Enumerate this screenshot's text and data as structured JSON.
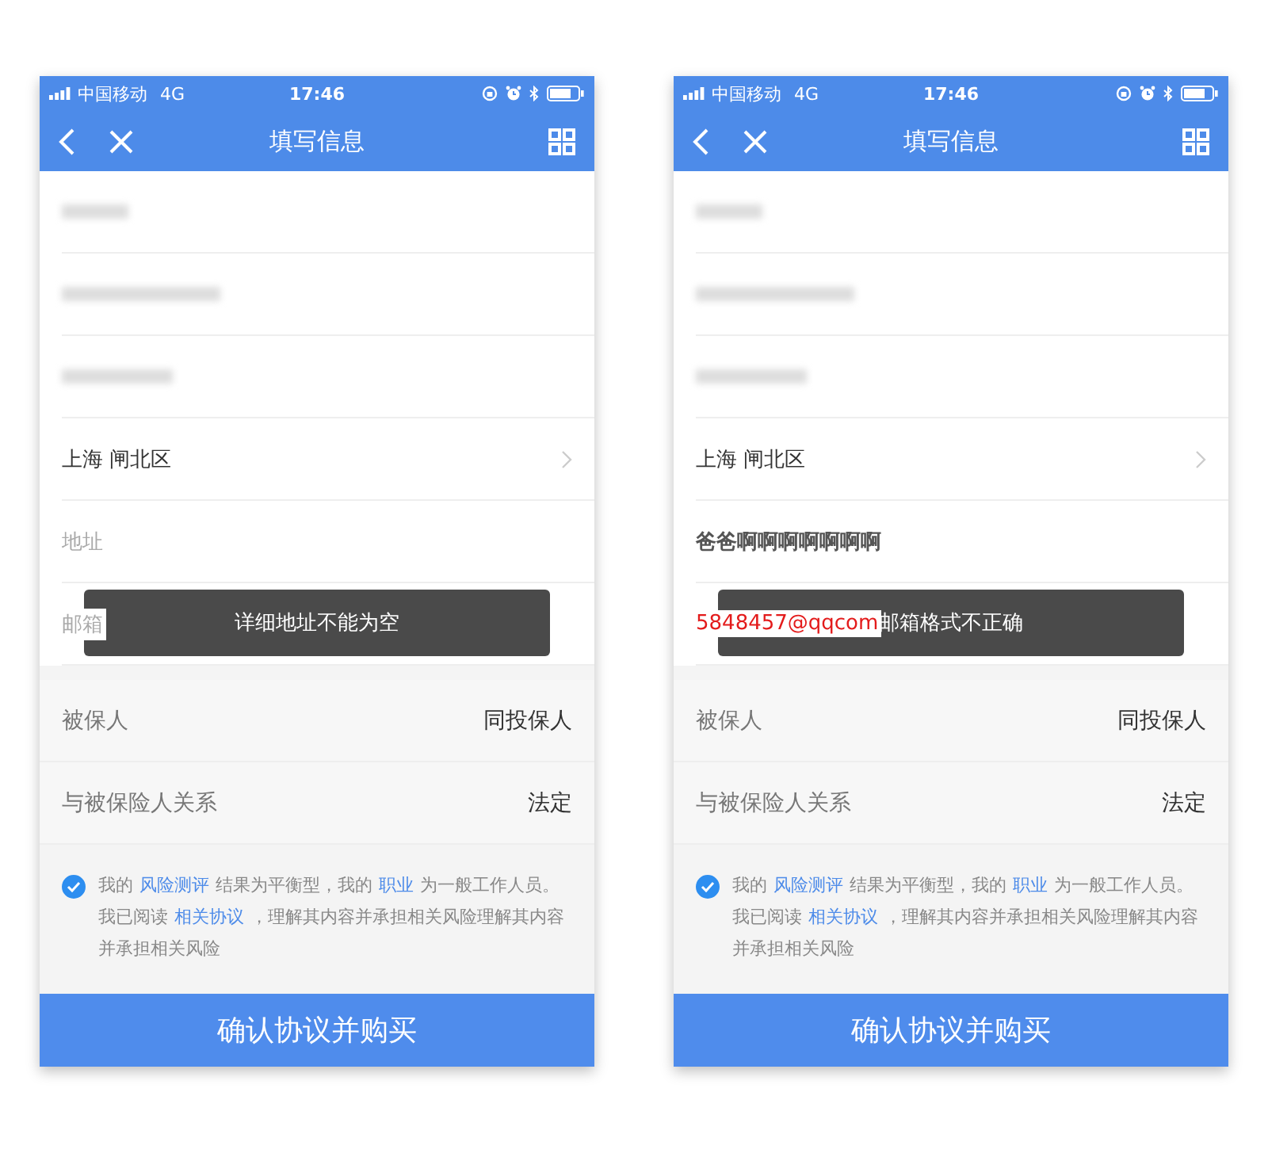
{
  "screens": [
    {
      "status_bar": {
        "carrier": "中国移动",
        "network": "4G",
        "time": "17:46"
      },
      "nav": {
        "title": "填写信息"
      },
      "fields": [
        {
          "kind": "blurred"
        },
        {
          "kind": "blurred"
        },
        {
          "kind": "blurred"
        },
        {
          "kind": "select",
          "value": "上海 闸北区"
        },
        {
          "kind": "input",
          "placeholder": "地址",
          "invalid": false
        },
        {
          "kind": "input",
          "placeholder": "邮箱",
          "invalid": false
        }
      ],
      "toast": "详细地址不能为空",
      "details": [
        {
          "label": "被保人",
          "value": "同投保人"
        },
        {
          "label": "与被保险人关系",
          "value": "法定"
        }
      ],
      "agreement": {
        "checked": true,
        "lines": [
          [
            {
              "text": "我的"
            },
            {
              "text": "风险测评",
              "link": true
            },
            {
              "text": "结果为平衡型，我的"
            },
            {
              "text": "职业",
              "link": true
            },
            {
              "text": "为一般工作人员。"
            }
          ],
          [
            {
              "text": "我已阅读"
            },
            {
              "text": "相关协议",
              "link": true
            },
            {
              "text": "，理解其内容并承担相关风险理解其内容并承担相关风险"
            }
          ]
        ]
      },
      "submit": "确认协议并购买"
    },
    {
      "status_bar": {
        "carrier": "中国移动",
        "network": "4G",
        "time": "17:46"
      },
      "nav": {
        "title": "填写信息"
      },
      "fields": [
        {
          "kind": "blurred"
        },
        {
          "kind": "blurred"
        },
        {
          "kind": "blurred"
        },
        {
          "kind": "select",
          "value": "上海 闸北区"
        },
        {
          "kind": "input",
          "value": "爸爸啊啊啊啊啊啊啊",
          "invalid": false
        },
        {
          "kind": "input",
          "value": "5848457@qqcom",
          "invalid": true
        }
      ],
      "toast": "邮箱格式不正确",
      "details": [
        {
          "label": "被保人",
          "value": "同投保人"
        },
        {
          "label": "与被保险人关系",
          "value": "法定"
        }
      ],
      "agreement": {
        "checked": true,
        "lines": [
          [
            {
              "text": "我的"
            },
            {
              "text": "风险测评",
              "link": true
            },
            {
              "text": "结果为平衡型，我的"
            },
            {
              "text": "职业",
              "link": true
            },
            {
              "text": "为一般工作人员。"
            }
          ],
          [
            {
              "text": "我已阅读"
            },
            {
              "text": "相关协议",
              "link": true
            },
            {
              "text": "，理解其内容并承担相关风险理解其内容并承担相关风险"
            }
          ]
        ]
      },
      "submit": "确认协议并购买"
    }
  ]
}
